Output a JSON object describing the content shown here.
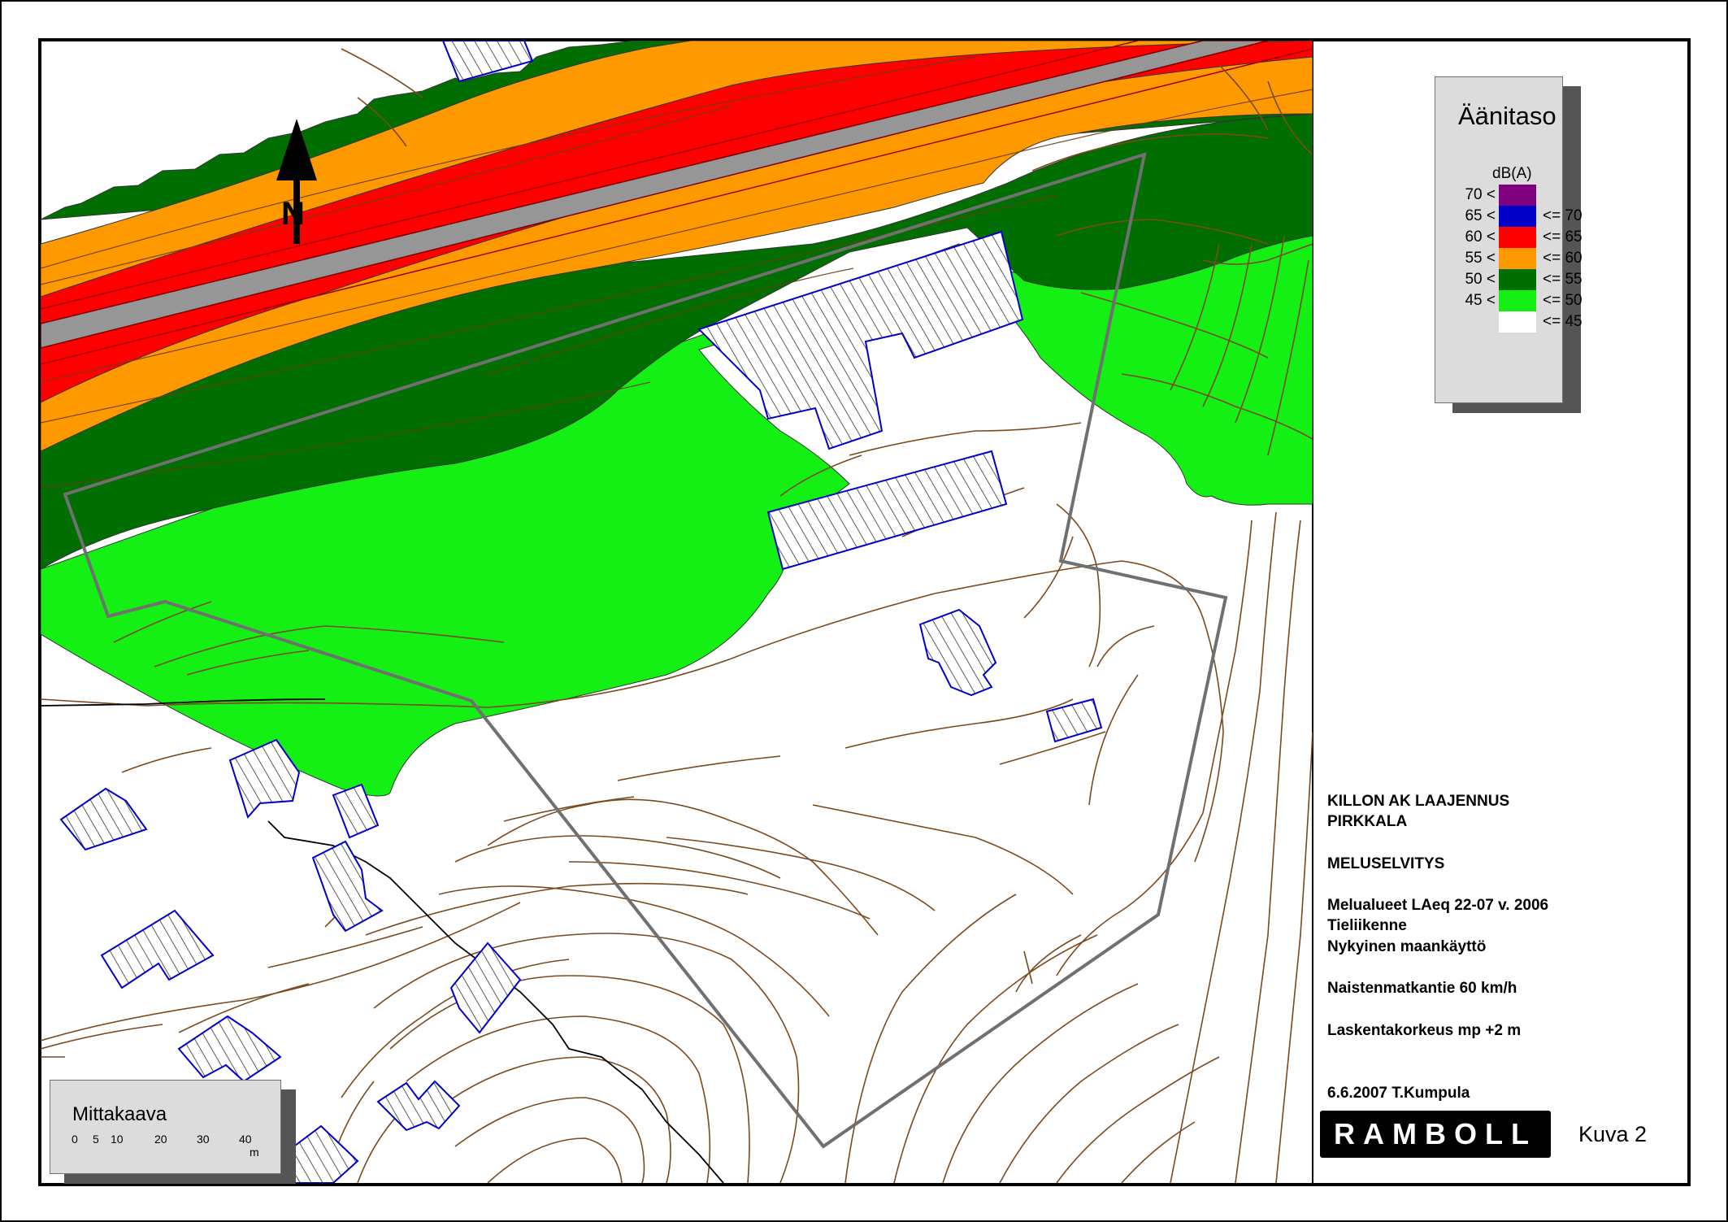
{
  "legend": {
    "title": "Äänitaso",
    "unit": "dB(A)",
    "classes": [
      {
        "low": "70 <",
        "high": "",
        "color": "#800080"
      },
      {
        "low": "65 <",
        "high": "<= 70",
        "color": "#0000c8"
      },
      {
        "low": "60 <",
        "high": "<= 65",
        "color": "#ff0000"
      },
      {
        "low": "55 <",
        "high": "<= 60",
        "color": "#ff9900"
      },
      {
        "low": "50 <",
        "high": "<= 55",
        "color": "#006e00"
      },
      {
        "low": "45 <",
        "high": "<= 50",
        "color": "#14f014"
      },
      {
        "low": "",
        "high": "<= 45",
        "color": "#ffffff"
      }
    ]
  },
  "north_arrow": {
    "label": "N"
  },
  "scale": {
    "title": "Mittakaava",
    "ticks": [
      "0",
      "5",
      "10",
      "20",
      "30",
      "40"
    ],
    "unit": "m"
  },
  "info": {
    "project_line1": "KILLON AK LAAJENNUS",
    "project_line2": "PIRKKALA",
    "report": "MELUSELVITYS",
    "desc_line1": "Melualueet LAeq 22-07 v. 2006",
    "desc_line2": "Tieliikenne",
    "desc_line3": "Nykyinen maankäyttö",
    "road": "Naistenmatkantie 60 km/h",
    "height": "Laskentakorkeus mp +2 m",
    "date_author": "6.6.2007 T.Kumpula"
  },
  "logo": "RAMBOLL",
  "figure_label": "Kuva 2",
  "colors": {
    "road": "#969696",
    "contour": "#7a4a1e",
    "building_outline": "#0000c8",
    "plan_boundary": "#707070"
  }
}
